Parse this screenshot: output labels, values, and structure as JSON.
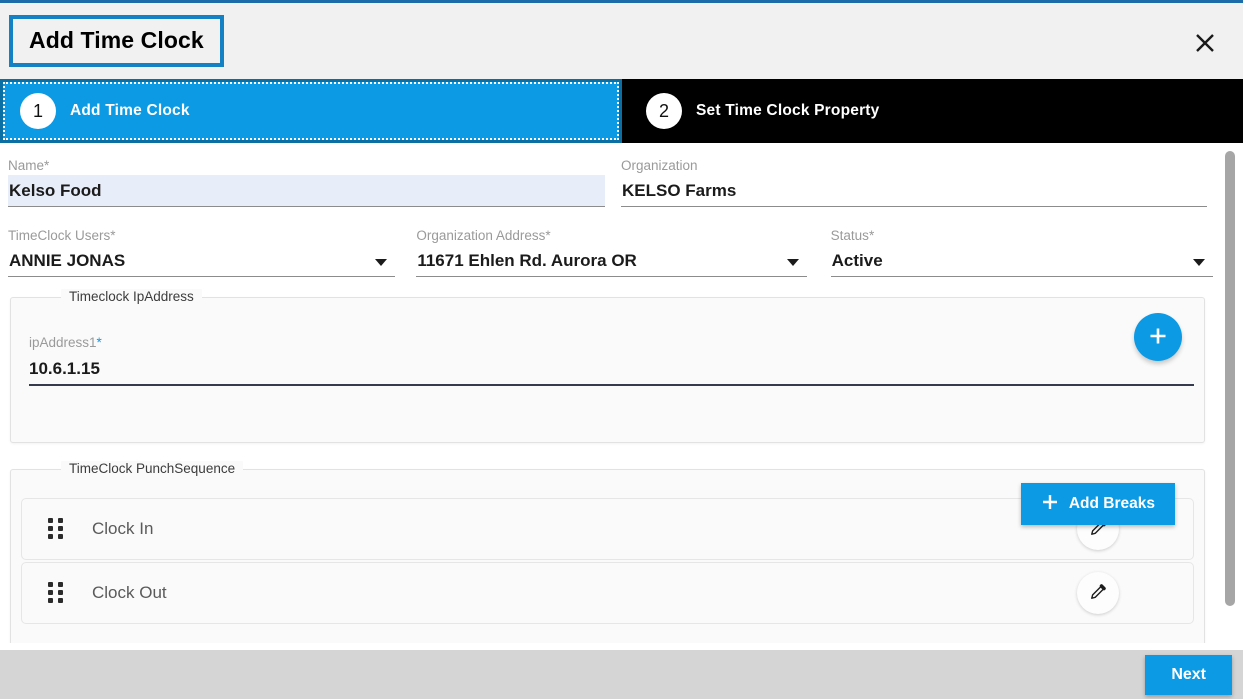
{
  "dialog": {
    "title": "Add Time Clock",
    "close_icon": "close-icon",
    "accent_color": "#0c9ae5",
    "title_border_color": "#1381c4"
  },
  "stepper": {
    "steps": [
      {
        "number": "1",
        "label": "Add Time Clock",
        "active": true
      },
      {
        "number": "2",
        "label": "Set Time Clock Property",
        "active": false
      }
    ]
  },
  "form": {
    "name": {
      "label": "Name",
      "required_mark": "*",
      "value": "Kelso Food"
    },
    "organization": {
      "label": "Organization",
      "required_mark": "",
      "value": "KELSO Farms"
    },
    "timeclock_users": {
      "label": "TimeClock Users",
      "required_mark": "*",
      "value": "ANNIE JONAS",
      "caret_icon": "chevron-down-icon"
    },
    "organization_address": {
      "label": "Organization Address",
      "required_mark": "*",
      "value": "11671 Ehlen Rd. Aurora OR",
      "caret_icon": "chevron-down-icon"
    },
    "status": {
      "label": "Status",
      "required_mark": "*",
      "value": "Active",
      "caret_icon": "chevron-down-icon"
    }
  },
  "ip_group": {
    "legend": "Timeclock IpAddress",
    "field_label": "ipAddress1",
    "required_mark": "*",
    "value": "10.6.1.15",
    "add_button_icon": "plus-icon"
  },
  "punch_group": {
    "legend": "TimeClock PunchSequence",
    "add_breaks_label": "Add Breaks",
    "add_breaks_icon": "plus-icon",
    "rows": [
      {
        "label": "Clock In",
        "drag_icon": "drag-handle-icon",
        "edit_icon": "pencil-icon"
      },
      {
        "label": "Clock Out",
        "drag_icon": "drag-handle-icon",
        "edit_icon": "pencil-icon"
      }
    ]
  },
  "footer": {
    "next_label": "Next"
  },
  "scrollbar": {
    "orientation": "vertical"
  }
}
